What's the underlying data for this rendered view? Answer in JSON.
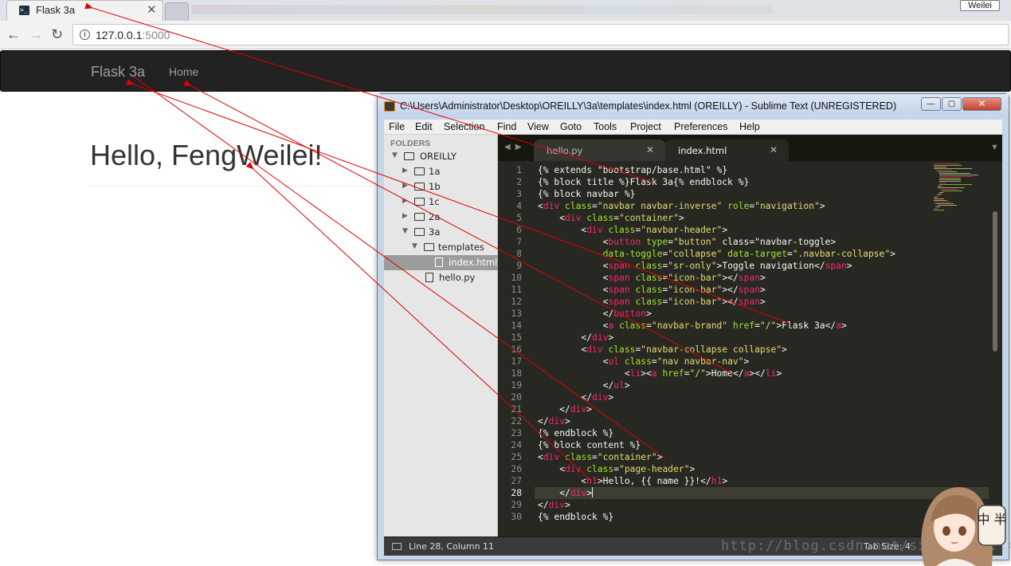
{
  "browser": {
    "tab_title": "Flask 3a",
    "tab_close": "✕",
    "user_badge": "Weilei",
    "url_host": "127.0.0.1",
    "url_port": ":5000",
    "back_icon": "←",
    "forward_icon": "→",
    "reload_icon": "↻"
  },
  "site": {
    "brand": "Flask 3a",
    "nav_home": "Home",
    "heading": "Hello, FengWeilei!"
  },
  "sublime": {
    "title": "C:\\Users\\Administrator\\Desktop\\OREILLY\\3a\\templates\\index.html (OREILLY) - Sublime Text (UNREGISTERED)",
    "window_buttons": {
      "minimize": "—",
      "maximize": "▢",
      "close": "✕"
    },
    "menu": [
      "File",
      "Edit",
      "Selection",
      "Find",
      "View",
      "Goto",
      "Tools",
      "Project",
      "Preferences",
      "Help"
    ],
    "sidebar": {
      "header": "FOLDERS",
      "items": [
        {
          "label": "OREILLY",
          "type": "folder",
          "expanded": true
        },
        {
          "label": "1a",
          "type": "folder",
          "expanded": false
        },
        {
          "label": "1b",
          "type": "folder",
          "expanded": false
        },
        {
          "label": "1c",
          "type": "folder",
          "expanded": false
        },
        {
          "label": "2a",
          "type": "folder",
          "expanded": false
        },
        {
          "label": "3a",
          "type": "folder",
          "expanded": true
        },
        {
          "label": "templates",
          "type": "folder",
          "expanded": true
        },
        {
          "label": "index.html",
          "type": "file",
          "selected": true
        },
        {
          "label": "hello.py",
          "type": "file"
        }
      ]
    },
    "tabs": [
      {
        "label": "hello.py",
        "active": false
      },
      {
        "label": "index.html",
        "active": true
      }
    ],
    "tab_close": "✕",
    "current_line": 28,
    "lines": [
      "{% extends \"bootstrap/base.html\" %}",
      "{% block title %}Flask 3a{% endblock %}",
      "{% block navbar %}",
      "<div class=\"navbar navbar-inverse\" role=\"navigation\">",
      "    <div class=\"container\">",
      "        <div class=\"navbar-header\">",
      "            <button type=\"button\" class=\"navbar-toggle\"",
      "            data-toggle=\"collapse\" data-target=\".navbar-collapse\">",
      "            <span class=\"sr-only\">Toggle navigation</span>",
      "            <span class=\"icon-bar\"></span>",
      "            <span class=\"icon-bar\"></span>",
      "            <span class=\"icon-bar\"></span>",
      "            </button>",
      "            <a class=\"navbar-brand\" href=\"/\">Flask 3a</a>",
      "        </div>",
      "        <div class=\"navbar-collapse collapse\">",
      "            <ul class=\"nav navbar-nav\">",
      "                <li><a href=\"/\">Home</a></li>",
      "            </ul>",
      "        </div>",
      "    </div>",
      "</div>",
      "{% endblock %}",
      "{% block content %}",
      "<div class=\"container\">",
      "    <div class=\"page-header\">",
      "        <h1>Hello, {{ name }}!</h1>",
      "    </div>",
      "</div>",
      "{% endblock %}"
    ],
    "status_position": "Line 28, Column 11",
    "status_tab_size": "Tab Size: 4"
  },
  "watermark": "http://blog.csdn.net/sinat_34...44",
  "mascot_badge": "中 半",
  "colors": {
    "navbar_bg": "#222222",
    "editor_bg": "#272822",
    "tag": "#f92672",
    "attr": "#a6e22e",
    "string": "#e6db74",
    "annotation_arrow": "#e00000"
  }
}
